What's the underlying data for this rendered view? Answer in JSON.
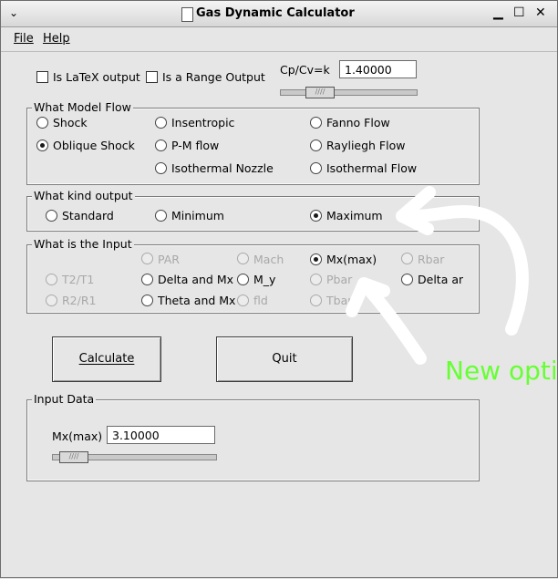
{
  "window": {
    "title": "Gas Dynamic Calculator",
    "menu_glyph": "⌄",
    "minimize_glyph": "▁",
    "maximize_glyph": "☐",
    "close_glyph": "✕"
  },
  "menubar": {
    "file": "File",
    "help": "Help"
  },
  "options": {
    "latex_label": "Is LaTeX output",
    "latex_checked": false,
    "range_label": "Is a Range Output",
    "range_checked": false,
    "k_label": "Cp/Cv=k",
    "k_value": "1.40000",
    "k_slider_level": 0.2
  },
  "model_flow": {
    "title": "What Model Flow",
    "items": [
      "Shock",
      "Insentropic",
      "Fanno Flow",
      "Oblique Shock",
      "P-M flow",
      "Rayliegh Flow",
      "Isothermal Nozzle",
      "Isothermal Flow"
    ],
    "selected": "Oblique Shock"
  },
  "output_kind": {
    "title": "What kind output",
    "items": [
      "Standard",
      "Minimum",
      "Maximum"
    ],
    "selected": "Maximum"
  },
  "input_kind": {
    "title": "What is the Input",
    "items": [
      "PAR",
      "Mach",
      "Mx(max)",
      "Rbar",
      "T2/T1",
      "Delta and Mx",
      "M_y",
      "Pbar",
      "Delta and",
      "R2/R1",
      "Theta and Mx",
      "fld",
      "Tbar"
    ],
    "disabled": [
      "PAR",
      "Mach",
      "Rbar",
      "T2/T1",
      "Pbar",
      "R2/R1",
      "fld",
      "Tbar"
    ],
    "selected": "Mx(max)"
  },
  "buttons": {
    "calculate": "Calculate",
    "quit": "Quit"
  },
  "input_data": {
    "title": "Input Data",
    "field_label": "Mx(max)",
    "field_value": "3.10000",
    "slider_level": 0.1
  },
  "annotation": {
    "text": "New optio",
    "color": "#66ff33"
  }
}
